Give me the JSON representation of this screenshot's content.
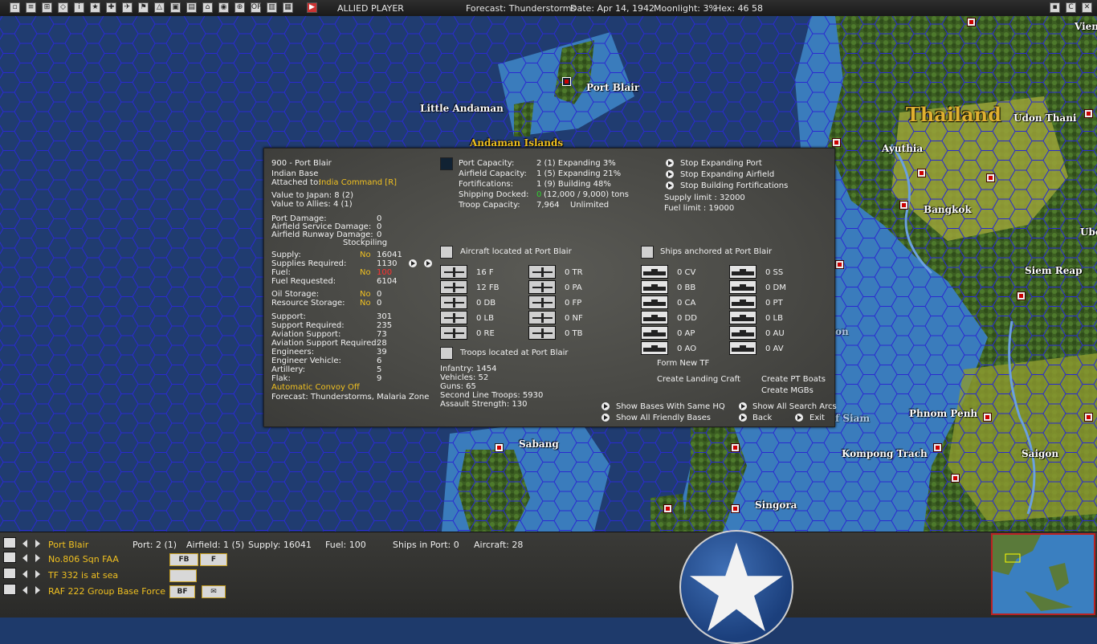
{
  "top_bar": {
    "player": "ALLIED PLAYER",
    "forecast": "Forecast: Thunderstorms",
    "date": "Date: Apr 14, 1942",
    "moonlight": "Moonlight: 3%",
    "hex": "Hex: 46 58",
    "icons": [
      "map-icon",
      "document-icon",
      "group-icon",
      "ship-icon",
      "info-icon",
      "medal-icon",
      "target-icon",
      "plane-icon",
      "flag-icon",
      "carrier-icon",
      "tank-icon",
      "supply-icon",
      "convoy-icon",
      "globe-icon",
      "recon-icon",
      "ops-icon",
      "intel-icon",
      "report-icon",
      "play-icon"
    ],
    "right_icons": [
      "flag-icon",
      "cargo-icon",
      "close-icon"
    ],
    "op_label": "OP"
  },
  "map": {
    "places": [
      {
        "id": "port-blair",
        "label": "Port Blair"
      },
      {
        "id": "little-andaman",
        "label": "Little Andaman"
      },
      {
        "id": "andaman-islands",
        "label": "Andaman Islands"
      },
      {
        "id": "thailand",
        "label": "Thailand"
      },
      {
        "id": "udon-thani",
        "label": "Udon Thani"
      },
      {
        "id": "ayuthia",
        "label": "Ayuthia"
      },
      {
        "id": "bangkok",
        "label": "Bangkok"
      },
      {
        "id": "siem-reap",
        "label": "Siem Reap"
      },
      {
        "id": "phnom-penh",
        "label": "Phnom Penh"
      },
      {
        "id": "kompong-trach",
        "label": "Kompong Trach"
      },
      {
        "id": "saigon",
        "label": "Saigon"
      },
      {
        "id": "sabang",
        "label": "Sabang"
      },
      {
        "id": "singora",
        "label": "Singora"
      },
      {
        "id": "vien",
        "label": "Vien"
      },
      {
        "id": "ubo",
        "label": "Ubo"
      },
      {
        "id": "siam",
        "label": "f Siam"
      },
      {
        "id": "on",
        "label": "on"
      }
    ]
  },
  "dialog": {
    "base_title": "900 - Port Blair",
    "base_type": "Indian Base",
    "attached_label": "Attached to:",
    "attached_value": "India Command [R]",
    "value_japan": "Value to Japan: 8 (2)",
    "value_allies": "Value to Allies: 4 (1)",
    "damage": [
      {
        "label": "Port Damage:",
        "value": "0"
      },
      {
        "label": "Airfield Service Damage:",
        "value": "0"
      },
      {
        "label": "Airfield Runway Damage:",
        "value": "0"
      }
    ],
    "stockpiling": "Stockpiling",
    "supply": {
      "supply_label": "Supply:",
      "supply_flag": "No",
      "supply_value": "16041",
      "req_label": "Supplies Required:",
      "req_value": "1130",
      "fuel_label": "Fuel:",
      "fuel_flag": "No",
      "fuel_value": "100",
      "fuelreq_label": "Fuel Requested:",
      "fuelreq_value": "6104"
    },
    "storage": {
      "oil_label": "Oil Storage:",
      "oil_flag": "No",
      "oil_value": "0",
      "res_label": "Resource Storage:",
      "res_flag": "No",
      "res_value": "0"
    },
    "support": [
      {
        "label": "Support:",
        "value": "301"
      },
      {
        "label": "Support Required:",
        "value": "235"
      },
      {
        "label": "Aviation Support:",
        "value": "73"
      },
      {
        "label": "Aviation Support Required:",
        "value": "28"
      },
      {
        "label": "Engineers:",
        "value": "39"
      },
      {
        "label": "Engineer Vehicle:",
        "value": "6"
      },
      {
        "label": "Artillery:",
        "value": "5"
      },
      {
        "label": "Flak:",
        "value": "9"
      }
    ],
    "convoy": "Automatic Convoy Off",
    "forecast": "Forecast: Thunderstorms, Malaria Zone",
    "capacity": [
      {
        "label": "Port Capacity:",
        "value": "2 (1) Expanding 3%"
      },
      {
        "label": "Airfield Capacity:",
        "value": "1 (5) Expanding 21%"
      },
      {
        "label": "Fortifications:",
        "value": "1 (9) Building 48%"
      },
      {
        "label": "Shipping Docked:",
        "value_green": "0",
        "value": "(12,000 / 9,000) tons"
      },
      {
        "label": "Troop Capacity:",
        "value": "7,964",
        "extra": "Unlimited"
      }
    ],
    "actions_top": [
      "Stop Expanding Port",
      "Stop Expanding Airfield",
      "Stop Building Fortifications"
    ],
    "supply_limit": "Supply limit : 32000",
    "fuel_limit": "Fuel limit : 19000",
    "aircraft_header": "Aircraft located at Port Blair",
    "aircraft_left": [
      "16 F",
      "12 FB",
      "0 DB",
      "0 LB",
      "0 RE"
    ],
    "aircraft_right": [
      "0 TR",
      "0 PA",
      "0 FP",
      "0 NF",
      "0 TB"
    ],
    "ships_header": "Ships anchored at Port Blair",
    "ships_left": [
      "0 CV",
      "0 BB",
      "0 CA",
      "0 DD",
      "0 AP",
      "0 AO"
    ],
    "ships_right": [
      "0 SS",
      "0 DM",
      "0 PT",
      "0 LB",
      "0 AU",
      "0 AV"
    ],
    "form_tf": "Form New TF",
    "create_landing": "Create Landing Craft",
    "create_pt": "Create PT Boats",
    "create_mgb": "Create MGBs",
    "troops_header": "Troops located at Port Blair",
    "troops": [
      "Infantry: 1454",
      "Vehicles: 52",
      "Guns: 65",
      "Second Line Troops: 5930",
      "Assault Strength: 130"
    ],
    "bottom_actions": {
      "same_hq": "Show Bases With Same HQ",
      "friendly": "Show All Friendly Bases",
      "search_arcs": "Show All Search Arcs",
      "back": "Back",
      "exit": "Exit"
    }
  },
  "bottom_bar": {
    "row1": {
      "name": "Port Blair",
      "port": "Port: 2 (1)",
      "airfield": "Airfield: 1 (5)",
      "supply": "Supply: 16041",
      "fuel": "Fuel: 100",
      "ships": "Ships in Port: 0",
      "aircraft": "Aircraft: 28"
    },
    "row2": {
      "name": "No.806 Sqn FAA",
      "btn1": "FB",
      "btn2": "F"
    },
    "row3": {
      "name": "TF 332 is at sea"
    },
    "row4": {
      "name": "RAF 222 Group Base Force",
      "btn": "BF"
    }
  },
  "colors": {
    "accent_yellow": "#f0c020",
    "hex_grid": "#2a2aa0",
    "ocean": "#1e3a6b",
    "shallow": "#3a7fc0",
    "land": "#4a6e2a"
  }
}
